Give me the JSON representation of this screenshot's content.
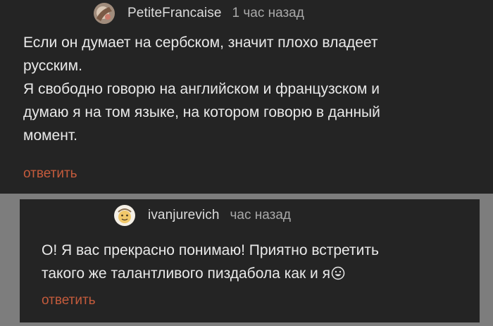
{
  "comments": [
    {
      "username": "PetiteFrancaise",
      "timestamp": "1 час назад",
      "body_lines": [
        "Если он думает на сербском, значит плохо владеет",
        "русским.",
        "Я свободно говорю на английском и французском и",
        "думаю я на том языке, на котором говорю в данный",
        "момент."
      ],
      "reply_label": "ответить"
    },
    {
      "username": "ivanjurevich",
      "timestamp": "час назад",
      "body_lines": [
        "О! Я вас прекрасно понимаю! Приятно встретить",
        "такого же талантливого пиздабола как и я"
      ],
      "reply_label": "ответить"
    }
  ],
  "colors": {
    "page_background": "#7d7d7d",
    "comment_background": "#242424",
    "reply_link": "#c45b3c"
  }
}
